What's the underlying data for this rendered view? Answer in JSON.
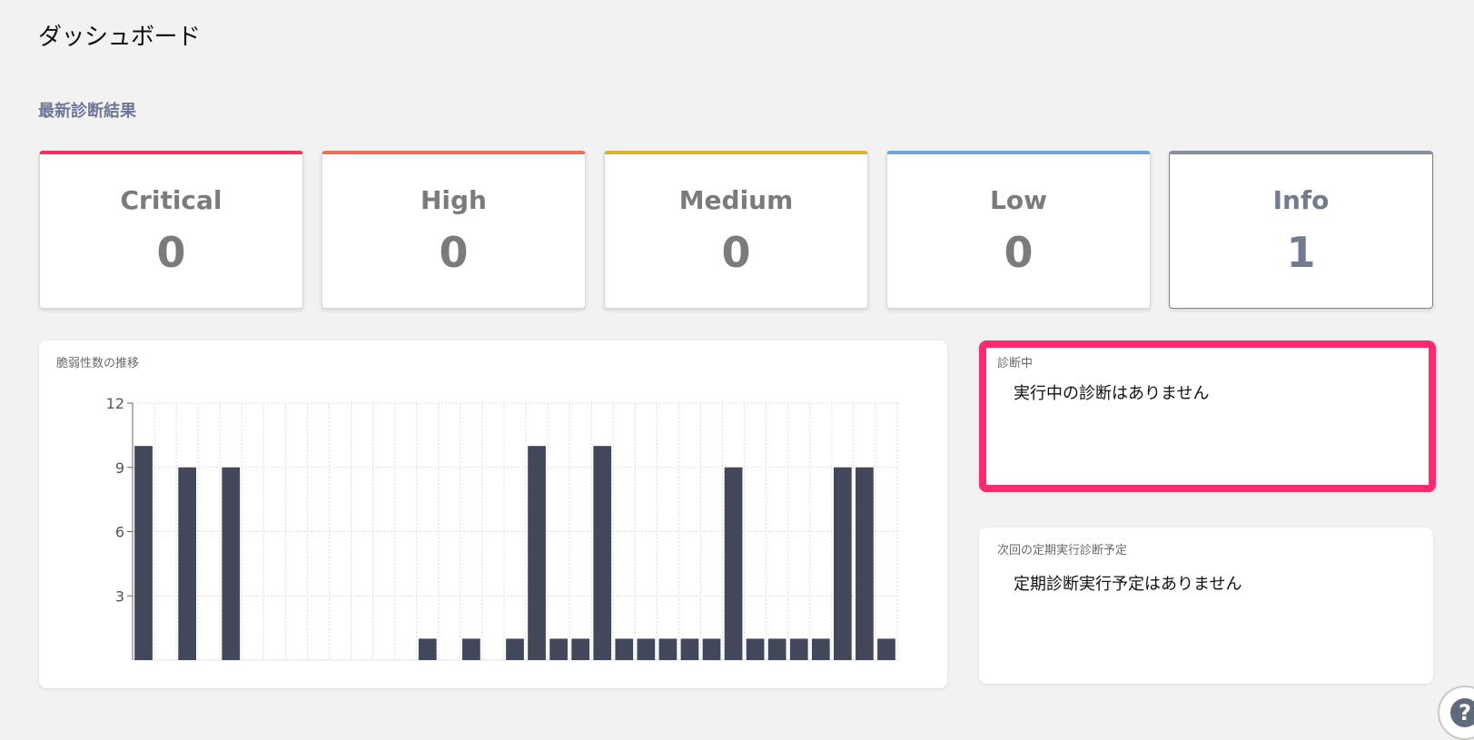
{
  "page": {
    "title": "ダッシュボード"
  },
  "latest": {
    "section_title": "最新診断結果",
    "cards": [
      {
        "label": "Critical",
        "count": "0",
        "color": "#e8365d"
      },
      {
        "label": "High",
        "count": "0",
        "color": "#e8735a"
      },
      {
        "label": "Medium",
        "count": "0",
        "color": "#d9b23a"
      },
      {
        "label": "Low",
        "count": "0",
        "color": "#6ea7d8"
      },
      {
        "label": "Info",
        "count": "1",
        "color": "#8a8e99"
      }
    ]
  },
  "trend": {
    "caption": "脆弱性数の推移"
  },
  "running": {
    "caption": "診断中",
    "message": "実行中の診断はありません",
    "highlight_color": "#ff2a6d"
  },
  "schedule": {
    "caption": "次回の定期実行診断予定",
    "message": "定期診断実行予定はありません"
  },
  "help": {
    "icon": "question-icon",
    "glyph": "?"
  },
  "chart_data": {
    "type": "bar",
    "title": "",
    "xlabel": "",
    "ylabel": "",
    "ylim": [
      0,
      12
    ],
    "yticks": [
      "3",
      "6",
      "9",
      "12"
    ],
    "bar_color": "#424759",
    "grid": true,
    "values": [
      10,
      0,
      9,
      0,
      9,
      0,
      0,
      0,
      0,
      0,
      0,
      0,
      0,
      1,
      0,
      1,
      0,
      1,
      10,
      1,
      1,
      10,
      1,
      1,
      1,
      1,
      1,
      9,
      1,
      1,
      1,
      1,
      9,
      9,
      1
    ]
  }
}
